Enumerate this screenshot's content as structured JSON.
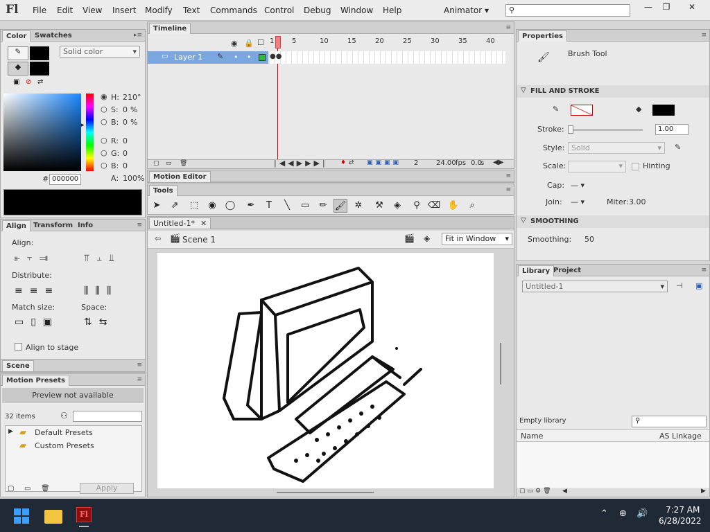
{
  "app": {
    "logo": "Fl",
    "workspace": "Animator"
  },
  "menu": [
    "File",
    "Edit",
    "View",
    "Insert",
    "Modify",
    "Text",
    "Commands",
    "Control",
    "Debug",
    "Window",
    "Help"
  ],
  "color_panel": {
    "tabs": [
      "Color",
      "Swatches"
    ],
    "fill_type": "Solid color",
    "hsb": {
      "h_label": "H:",
      "h": "210",
      "h_unit": "°",
      "s_label": "S:",
      "s": "0",
      "s_unit": "%",
      "b_label": "B:",
      "b": "0",
      "b_unit": "%"
    },
    "rgb": {
      "r_label": "R:",
      "r": "0",
      "g_label": "G:",
      "g": "0",
      "b_label": "B:",
      "b": "0"
    },
    "hex_label": "#",
    "hex": "000000",
    "alpha_label": "A:",
    "alpha": "100",
    "alpha_unit": "%",
    "swatch_color": "#000000"
  },
  "align_panel": {
    "tabs": [
      "Align",
      "Transform",
      "Info"
    ],
    "align_label": "Align:",
    "distribute_label": "Distribute:",
    "match_size_label": "Match size:",
    "space_label": "Space:",
    "align_to_stage": "Align to stage"
  },
  "scene_panel": {
    "title": "Scene"
  },
  "motion_presets": {
    "title": "Motion Presets",
    "preview": "Preview not available",
    "count": "32 items",
    "folders": [
      "Default Presets",
      "Custom Presets"
    ],
    "apply": "Apply"
  },
  "timeline": {
    "title": "Timeline",
    "frame_numbers": [
      "1",
      "5",
      "10",
      "15",
      "20",
      "25",
      "30",
      "35",
      "40"
    ],
    "layer": "Layer 1",
    "current_frame": "2",
    "fps": "24.00",
    "fps_unit": "fps",
    "time": "0.0",
    "time_unit": "s"
  },
  "motion_editor": {
    "title": "Motion Editor"
  },
  "tools": {
    "title": "Tools"
  },
  "document": {
    "tab": "Untitled-1*",
    "scene": "Scene 1",
    "zoom": "Fit in Window"
  },
  "properties": {
    "title": "Properties",
    "tool_name": "Brush Tool",
    "fill_stroke": "FILL AND STROKE",
    "stroke_label": "Stroke:",
    "stroke_value": "1.00",
    "style_label": "Style:",
    "style_value": "Solid",
    "scale_label": "Scale:",
    "hinting": "Hinting",
    "cap_label": "Cap:",
    "join_label": "Join:",
    "miter_label": "Miter:",
    "miter_value": "3.00",
    "smoothing_header": "SMOOTHING",
    "smoothing_label": "Smoothing:",
    "smoothing_value": "50",
    "fill_color": "#000000"
  },
  "library": {
    "tabs": [
      "Library",
      "Project"
    ],
    "doc": "Untitled-1",
    "empty": "Empty library",
    "col_name": "Name",
    "col_linkage": "AS Linkage"
  },
  "taskbar": {
    "time": "7:27 AM",
    "date": "6/28/2022"
  }
}
